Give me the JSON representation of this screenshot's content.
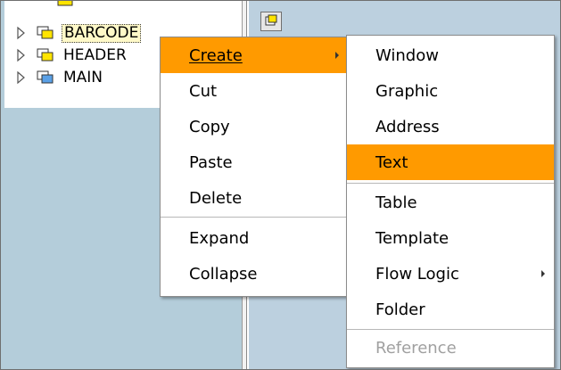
{
  "tree": {
    "nodes": [
      {
        "label": "BARCODE",
        "selected": true
      },
      {
        "label": "HEADER",
        "selected": false
      },
      {
        "label": "MAIN",
        "selected": false
      }
    ]
  },
  "context_menu": {
    "items": [
      {
        "label": "Create",
        "highlighted": true,
        "submenu": true
      },
      {
        "label": "Cut"
      },
      {
        "label": "Copy"
      },
      {
        "label": "Paste"
      },
      {
        "label": "Delete"
      },
      {
        "label": "Expand"
      },
      {
        "label": "Collapse"
      }
    ]
  },
  "create_submenu": {
    "items": [
      {
        "label": "Window"
      },
      {
        "label": "Graphic"
      },
      {
        "label": "Address"
      },
      {
        "label": "Text",
        "highlighted": true
      },
      {
        "label": "Table"
      },
      {
        "label": "Template"
      },
      {
        "label": "Flow Logic",
        "submenu": true
      },
      {
        "label": "Folder"
      },
      {
        "label": "Reference",
        "disabled": true
      }
    ]
  },
  "colors": {
    "highlight": "#ff9a00",
    "panel_bg": "#b4cdda",
    "folder_yellow": "#ffe400",
    "folder_blue": "#5aa0e6"
  }
}
